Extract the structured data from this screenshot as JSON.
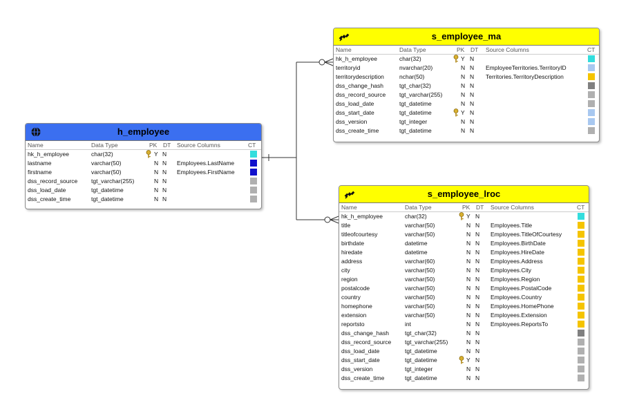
{
  "colors": {
    "hub_header": "#3b6ff0",
    "sat_header": "#ffff00",
    "line": "#333333",
    "key": "#c9a227"
  },
  "column_headers": {
    "name": "Name",
    "data_type": "Data Type",
    "pk": "PK",
    "dt": "DT",
    "source": "Source Columns",
    "ct": "CT"
  },
  "tables": [
    {
      "id": "h_employee",
      "title": "h_employee",
      "icon": "globe-icon",
      "header_color": "#3b6ff0",
      "rows": [
        {
          "name": "hk_h_employee",
          "type": "char(32)",
          "pk": "Y",
          "dt": "N",
          "source": "",
          "ct": "#33dddd",
          "key": true
        },
        {
          "name": "lastname",
          "type": "varchar(50)",
          "pk": "N",
          "dt": "N",
          "source": "Employees.LastName",
          "ct": "#1010cc",
          "key": false
        },
        {
          "name": "firstname",
          "type": "varchar(50)",
          "pk": "N",
          "dt": "N",
          "source": "Employees.FirstName",
          "ct": "#1010cc",
          "key": false
        },
        {
          "name": "dss_record_source",
          "type": "tgt_varchar(255)",
          "pk": "N",
          "dt": "N",
          "source": "",
          "ct": "#b0b0b0",
          "key": false
        },
        {
          "name": "dss_load_date",
          "type": "tgt_datetime",
          "pk": "N",
          "dt": "N",
          "source": "",
          "ct": "#b0b0b0",
          "key": false
        },
        {
          "name": "dss_create_time",
          "type": "tgt_datetime",
          "pk": "N",
          "dt": "N",
          "source": "",
          "ct": "#b0b0b0",
          "key": false
        }
      ]
    },
    {
      "id": "s_employee_ma",
      "title": "s_employee_ma",
      "icon": "satellite-icon",
      "header_color": "#ffff00",
      "rows": [
        {
          "name": "hk_h_employee",
          "type": "char(32)",
          "pk": "Y",
          "dt": "N",
          "source": "",
          "ct": "#33dddd",
          "key": true
        },
        {
          "name": "territoryid",
          "type": "nvarchar(20)",
          "pk": "N",
          "dt": "N",
          "source": "EmployeeTerritories.TerritoryID",
          "ct": "#a8c8f0",
          "key": false
        },
        {
          "name": "territorydescription",
          "type": "nchar(50)",
          "pk": "N",
          "dt": "N",
          "source": "Territories.TerritoryDescription",
          "ct": "#f5c400",
          "key": false
        },
        {
          "name": "dss_change_hash",
          "type": "tgt_char(32)",
          "pk": "N",
          "dt": "N",
          "source": "",
          "ct": "#808080",
          "key": false
        },
        {
          "name": "dss_record_source",
          "type": "tgt_varchar(255)",
          "pk": "N",
          "dt": "N",
          "source": "",
          "ct": "#b0b0b0",
          "key": false
        },
        {
          "name": "dss_load_date",
          "type": "tgt_datetime",
          "pk": "N",
          "dt": "N",
          "source": "",
          "ct": "#b0b0b0",
          "key": false
        },
        {
          "name": "dss_start_date",
          "type": "tgt_datetime",
          "pk": "Y",
          "dt": "N",
          "source": "",
          "ct": "#a8c8f0",
          "key": true
        },
        {
          "name": "dss_version",
          "type": "tgt_integer",
          "pk": "N",
          "dt": "N",
          "source": "",
          "ct": "#a8c8f0",
          "key": false
        },
        {
          "name": "dss_create_time",
          "type": "tgt_datetime",
          "pk": "N",
          "dt": "N",
          "source": "",
          "ct": "#b0b0b0",
          "key": false
        }
      ]
    },
    {
      "id": "s_employee_lroc",
      "title": "s_employee_lroc",
      "icon": "satellite-icon",
      "header_color": "#ffff00",
      "rows": [
        {
          "name": "hk_h_employee",
          "type": "char(32)",
          "pk": "Y",
          "dt": "N",
          "source": "",
          "ct": "#33dddd",
          "key": true
        },
        {
          "name": "title",
          "type": "varchar(50)",
          "pk": "N",
          "dt": "N",
          "source": "Employees.Title",
          "ct": "#f5c400",
          "key": false
        },
        {
          "name": "titleofcourtesy",
          "type": "varchar(50)",
          "pk": "N",
          "dt": "N",
          "source": "Employees.TitleOfCourtesy",
          "ct": "#f5c400",
          "key": false
        },
        {
          "name": "birthdate",
          "type": "datetime",
          "pk": "N",
          "dt": "N",
          "source": "Employees.BirthDate",
          "ct": "#f5c400",
          "key": false
        },
        {
          "name": "hiredate",
          "type": "datetime",
          "pk": "N",
          "dt": "N",
          "source": "Employees.HireDate",
          "ct": "#f5c400",
          "key": false
        },
        {
          "name": "address",
          "type": "varchar(60)",
          "pk": "N",
          "dt": "N",
          "source": "Employees.Address",
          "ct": "#f5c400",
          "key": false
        },
        {
          "name": "city",
          "type": "varchar(50)",
          "pk": "N",
          "dt": "N",
          "source": "Employees.City",
          "ct": "#f5c400",
          "key": false
        },
        {
          "name": "region",
          "type": "varchar(50)",
          "pk": "N",
          "dt": "N",
          "source": "Employees.Region",
          "ct": "#f5c400",
          "key": false
        },
        {
          "name": "postalcode",
          "type": "varchar(50)",
          "pk": "N",
          "dt": "N",
          "source": "Employees.PostalCode",
          "ct": "#f5c400",
          "key": false
        },
        {
          "name": "country",
          "type": "varchar(50)",
          "pk": "N",
          "dt": "N",
          "source": "Employees.Country",
          "ct": "#f5c400",
          "key": false
        },
        {
          "name": "homephone",
          "type": "varchar(50)",
          "pk": "N",
          "dt": "N",
          "source": "Employees.HomePhone",
          "ct": "#f5c400",
          "key": false
        },
        {
          "name": "extension",
          "type": "varchar(50)",
          "pk": "N",
          "dt": "N",
          "source": "Employees.Extension",
          "ct": "#f5c400",
          "key": false
        },
        {
          "name": "reportsto",
          "type": "int",
          "pk": "N",
          "dt": "N",
          "source": "Employees.ReportsTo",
          "ct": "#f5c400",
          "key": false
        },
        {
          "name": "dss_change_hash",
          "type": "tgt_char(32)",
          "pk": "N",
          "dt": "N",
          "source": "",
          "ct": "#808080",
          "key": false
        },
        {
          "name": "dss_record_source",
          "type": "tgt_varchar(255)",
          "pk": "N",
          "dt": "N",
          "source": "",
          "ct": "#b0b0b0",
          "key": false
        },
        {
          "name": "dss_load_date",
          "type": "tgt_datetime",
          "pk": "N",
          "dt": "N",
          "source": "",
          "ct": "#b0b0b0",
          "key": false
        },
        {
          "name": "dss_start_date",
          "type": "tgt_datetime",
          "pk": "Y",
          "dt": "N",
          "source": "",
          "ct": "#b0b0b0",
          "key": true
        },
        {
          "name": "dss_version",
          "type": "tgt_integer",
          "pk": "N",
          "dt": "N",
          "source": "",
          "ct": "#b0b0b0",
          "key": false
        },
        {
          "name": "dss_create_time",
          "type": "tgt_datetime",
          "pk": "N",
          "dt": "N",
          "source": "",
          "ct": "#b0b0b0",
          "key": false
        }
      ]
    }
  ]
}
